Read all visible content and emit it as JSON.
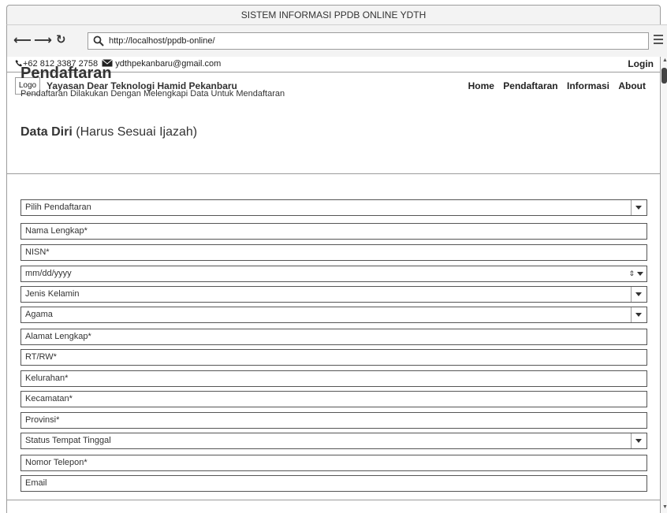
{
  "window": {
    "title": "SISTEM INFORMASI PPDB ONLINE YDTH"
  },
  "browser": {
    "url": "http://localhost/ppdb-online/"
  },
  "topbar": {
    "phone": "+62 812 3387 2758",
    "email": "ydthpekanbaru@gmail.com",
    "login": "Login"
  },
  "header": {
    "logo": "Logo",
    "site_name": "Yayasan Dear Teknologi Hamid Pekanbaru",
    "nav": [
      "Home",
      "Pendaftaran",
      "Informasi",
      "About"
    ]
  },
  "page": {
    "title": "Pendaftaran",
    "subtitle": "Pendaftaran Dilakukan Dengan Melengkapi Data Untuk Mendaftaran"
  },
  "form": {
    "section_title_bold": "Data Diri",
    "section_title_rest": "(Harus Sesuai Ijazah)",
    "fields": [
      {
        "label": "Pilih Pendaftaran",
        "type": "select"
      },
      {
        "label": "Nama Lengkap*",
        "type": "text"
      },
      {
        "label": "NISN*",
        "type": "text"
      },
      {
        "label": "mm/dd/yyyy",
        "type": "date"
      },
      {
        "label": "Jenis Kelamin",
        "type": "select"
      },
      {
        "label": "Agama",
        "type": "select"
      },
      {
        "label": "Alamat Lengkap*",
        "type": "text"
      },
      {
        "label": "RT/RW*",
        "type": "text"
      },
      {
        "label": "Kelurahan*",
        "type": "text"
      },
      {
        "label": "Kecamatan*",
        "type": "text"
      },
      {
        "label": "Provinsi*",
        "type": "text"
      },
      {
        "label": "Status Tempat Tinggal",
        "type": "select"
      },
      {
        "label": "Nomor Telepon*",
        "type": "text"
      },
      {
        "label": "Email",
        "type": "text"
      }
    ]
  }
}
